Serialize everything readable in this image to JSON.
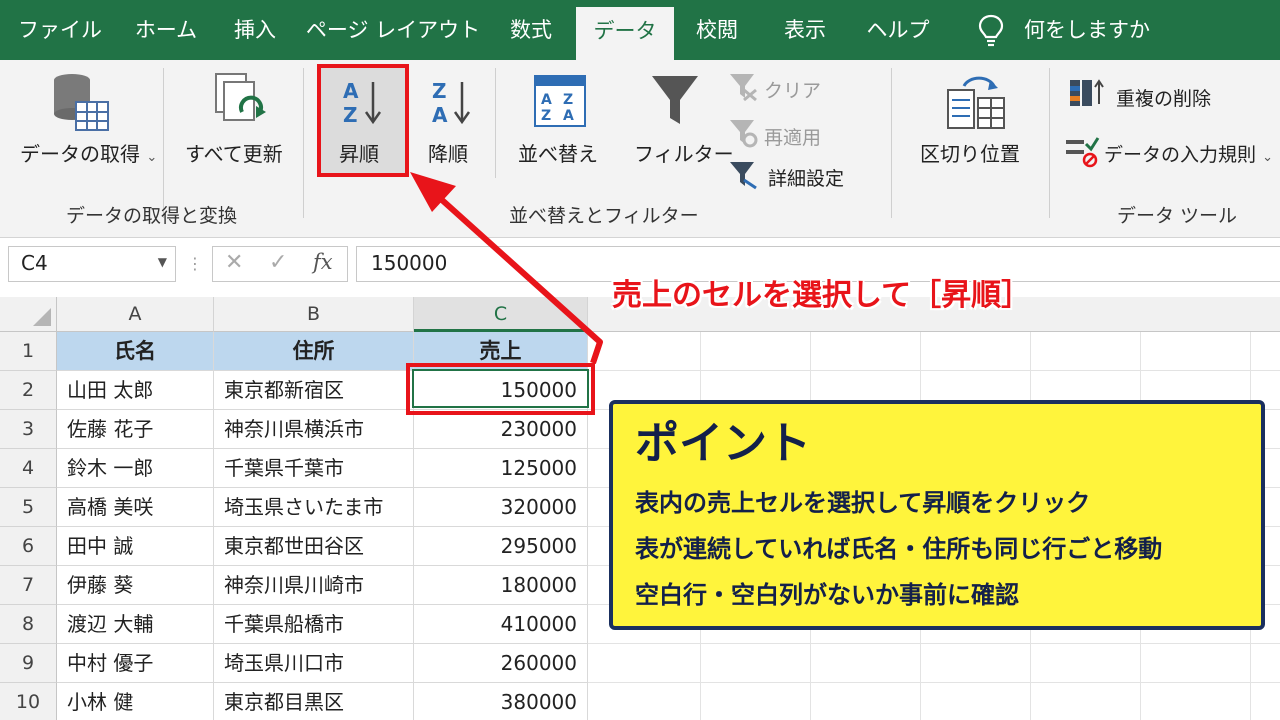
{
  "tabs": [
    "ファイル",
    "ホーム",
    "挿入",
    "ページ レイアウト",
    "数式",
    "データ",
    "校閲",
    "表示",
    "ヘルプ"
  ],
  "active_tab": "データ",
  "tell_me": "何をしますか",
  "ribbon": {
    "get_data": "データの取得",
    "refresh_all": "すべて更新",
    "sort_asc": "昇順",
    "sort_desc": "降順",
    "sort": "並べ替え",
    "filter": "フィルター",
    "clear": "クリア",
    "reapply": "再適用",
    "advanced": "詳細設定",
    "text_to_columns": "区切り位置",
    "remove_duplicates": "重複の削除",
    "data_validation": "データの入力規則",
    "group_get_data": "データの取得と変換",
    "group_sort_filter": "並べ替えとフィルター",
    "group_data_tools": "データ ツール"
  },
  "formula_bar": {
    "name_box": "C4",
    "cancel": "✕",
    "enter": "✓",
    "fx": "fx",
    "value": "150000"
  },
  "sheet": {
    "columns": [
      "A",
      "B",
      "C"
    ],
    "header": [
      "氏名",
      "住所",
      "売上"
    ],
    "rows": [
      [
        "山田 太郎",
        "東京都新宿区",
        "150000"
      ],
      [
        "佐藤 花子",
        "神奈川県横浜市",
        "230000"
      ],
      [
        "鈴木 一郎",
        "千葉県千葉市",
        "125000"
      ],
      [
        "高橋 美咲",
        "埼玉県さいたま市",
        "320000"
      ],
      [
        "田中 誠",
        "東京都世田谷区",
        "295000"
      ],
      [
        "伊藤 葵",
        "神奈川県川崎市",
        "180000"
      ],
      [
        "渡辺 大輔",
        "千葉県船橋市",
        "410000"
      ],
      [
        "中村 優子",
        "埼玉県川口市",
        "260000"
      ],
      [
        "小林 健",
        "東京都目黒区",
        "380000"
      ]
    ],
    "row_numbers": [
      "1",
      "2",
      "3",
      "4",
      "5",
      "6",
      "7",
      "8",
      "9",
      "10"
    ]
  },
  "annotation": "売上のセルを選択して［昇順］",
  "point_box": {
    "title": "ポイント",
    "lines": [
      "表内の売上セルを選択して昇順をクリック",
      "表が連続していれば氏名・住所も同じ行ごと移動",
      "空白行・空白列がないか事前に確認"
    ]
  },
  "colors": {
    "excel_green": "#217346",
    "highlight_red": "#e8141a",
    "point_yellow": "#fff43c",
    "header_blue": "#bdd7ee"
  }
}
